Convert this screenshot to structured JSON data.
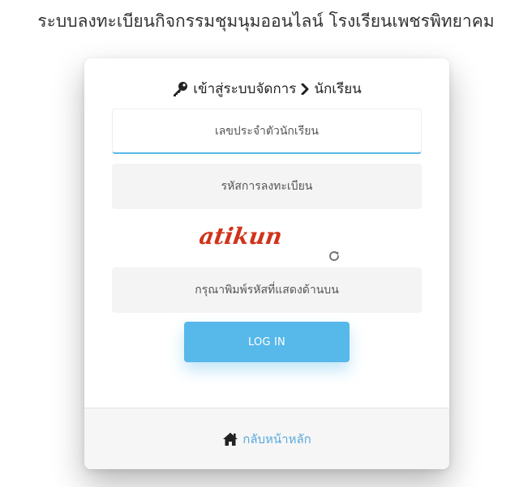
{
  "page": {
    "title": "ระบบลงทะเบียนกิจกรรมชุมนุมออนไลน์ โรงเรียนเพชรพิทยาคม"
  },
  "login_card": {
    "heading_prefix": "เข้าสู่ระบบจัดการ",
    "heading_suffix": "นักเรียน",
    "key_icon": "key-icon",
    "chevron_icon": "chevron-right-icon",
    "student_id_placeholder": "เลขประจำตัวนักเรียน",
    "password_placeholder": "รหัสการลงทะเบียน",
    "captcha_text": "atikun",
    "captcha_color": "#d0331a",
    "refresh_icon": "refresh-icon",
    "captcha_input_placeholder": "กรุณาพิมพ์รหัสที่แสดงด้านบน",
    "login_button_label": "LOG IN",
    "accent_color": "#57b8ea"
  },
  "footer": {
    "home_icon": "home-icon",
    "home_link_label": "กลับหน้าหลัก",
    "link_color": "#5aa9dc"
  }
}
